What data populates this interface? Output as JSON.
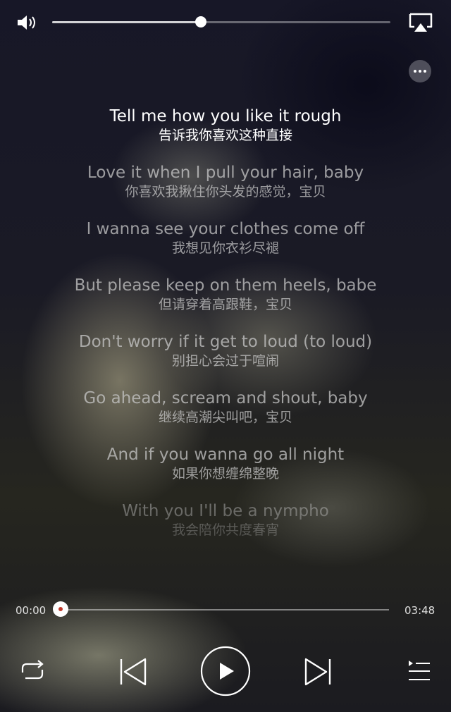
{
  "top_bar": {
    "volume_level": 0.44,
    "volume_icon": "speaker-icon",
    "airplay_icon": "airplay-icon",
    "more_icon": "more-icon"
  },
  "lyrics": [
    {
      "en": "Tell me how you like it rough",
      "zh": "告诉我你喜欢这种直接",
      "state": "current"
    },
    {
      "en": "Love it when I pull your hair, baby",
      "zh": "你喜欢我揪住你头发的感觉，宝贝",
      "state": "normal"
    },
    {
      "en": "I wanna see your clothes come off",
      "zh": "我想见你衣衫尽褪",
      "state": "normal"
    },
    {
      "en": "But please keep on them heels, babe",
      "zh": "但请穿着高跟鞋，宝贝",
      "state": "normal"
    },
    {
      "en": "Don't worry if it get to loud (to loud)",
      "zh": "别担心会过于喧闹",
      "state": "normal"
    },
    {
      "en": "Go ahead, scream and shout, baby",
      "zh": "继续高潮尖叫吧，宝贝",
      "state": "normal"
    },
    {
      "en": "And if you wanna go all night",
      "zh": "如果你想缠绵整晚",
      "state": "normal"
    },
    {
      "en": "With you I'll be a nympho",
      "zh": "我会陪你共度春宵",
      "state": "fade1"
    },
    {
      "en": "",
      "zh": "",
      "state": "fade2"
    }
  ],
  "progress": {
    "elapsed": "00:00",
    "total": "03:48",
    "fraction": 0.0
  },
  "controls": {
    "repeat_icon": "repeat-icon",
    "prev_icon": "previous-icon",
    "play_icon": "play-icon",
    "next_icon": "next-icon",
    "playlist_icon": "playlist-icon"
  }
}
